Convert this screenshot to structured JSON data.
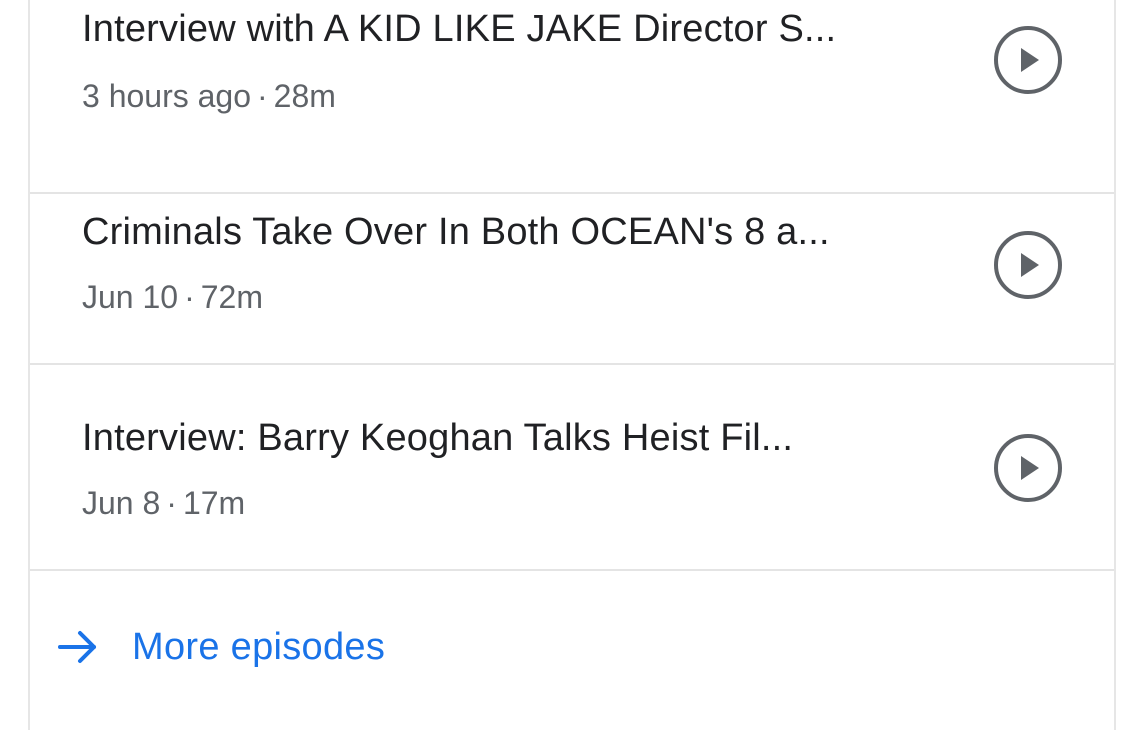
{
  "episodes": [
    {
      "title": "Interview with A KID LIKE JAKE Director S...",
      "date": "3 hours ago",
      "duration": "28m"
    },
    {
      "title": "Criminals Take Over In Both OCEAN's 8 a...",
      "date": "Jun 10",
      "duration": "72m"
    },
    {
      "title": "Interview: Barry Keoghan Talks Heist Fil...",
      "date": "Jun 8",
      "duration": "17m"
    }
  ],
  "more_episodes": {
    "label": "More episodes",
    "icon": "arrow-right-icon"
  },
  "colors": {
    "title": "#202124",
    "meta": "#5f6368",
    "accent": "#1a73e8",
    "icon": "#5f6368",
    "divider": "#e4e4e4"
  },
  "separator": "·"
}
